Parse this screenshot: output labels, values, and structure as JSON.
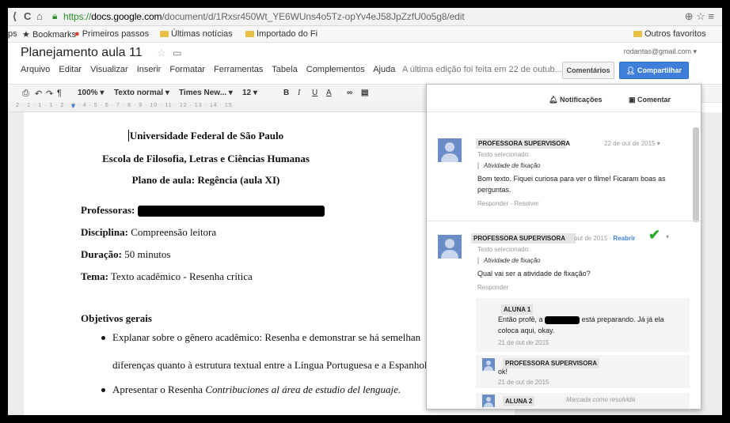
{
  "browser": {
    "url_https": "https://",
    "url_domain": "docs.google.com",
    "url_path": "/document/d/1Rxsr450Wt_YE6WUns4o5Tz-opYv4eJ58JpZzfU0o5g8/edit",
    "bookmarks": [
      {
        "label": "ps"
      },
      {
        "label": "Bookmarks"
      },
      {
        "label": "Primeiros passos"
      },
      {
        "label": "Últimas notícias"
      },
      {
        "label": "Importado do Fi"
      }
    ],
    "other_bookmarks": "Outros favoritos"
  },
  "doc": {
    "title": "Planejamento aula 11",
    "menu": [
      "Arquivo",
      "Editar",
      "Visualizar",
      "Inserir",
      "Formatar",
      "Ferramentas",
      "Tabela",
      "Complementos",
      "Ajuda"
    ],
    "last_edit": "A última edição foi feita em 22 de outub...",
    "user_email": "rodantas@gmail.com",
    "comments_button": "Comentários",
    "share_button": "Compartilhar"
  },
  "toolbar": {
    "zoom": "100%",
    "style": "Texto normal",
    "font": "Times New...",
    "size": "12",
    "bold": "B",
    "italic": "I",
    "underline": "U",
    "textcolor": "A"
  },
  "ruler": "2 · 1 · 1 · 1 · 2 · 3 · 4 · 5 · 6 · 7 · 8 · 9 · 10 · 11 · 12 · 13 · 14 · 15",
  "content": {
    "header1": "Universidade Federal de São Paulo",
    "header2": "Escola de Filosofia, Letras e Ciências Humanas",
    "header3": "Plano de aula: Regência (aula XI)",
    "professoras_label": "Professoras:",
    "disciplina_label": "Disciplina:",
    "disciplina_value": " Compreensão leitora",
    "duracao_label": "Duração:",
    "duracao_value": " 50 minutos",
    "tema_label": "Tema:",
    "tema_value": " Texto acadêmico - Resenha crítica",
    "objetivos": "Objetivos gerais",
    "bullet1_line1": "Explanar sobre o gênero acadêmico: Resenha e demonstrar se há semelhan",
    "bullet1_line2": "diferenças quanto à estrutura textual entre a Língua Portuguesa e a Espanhola.",
    "bullet2_prefix": "Apresentar o Resenha ",
    "bullet2_italic": "Contribuciones al área de estudio del lenguaje."
  },
  "comments": {
    "notifications": "Notificações",
    "comment_button": "Comentar",
    "thread1": {
      "author": "PROFESSORA SUPERVISORA",
      "date": "22 de out de 2015",
      "selected_label": "Texto selecionado:",
      "selected": "Atividade de fixação",
      "body": "Bom texto. Fiquei curiosa para ver o filme! Ficaram boas as perguntas.",
      "actions": "Responder - Resolver"
    },
    "thread2": {
      "author": "PROFESSORA SUPERVISORA",
      "date": "out de 2015 -",
      "reopen": "Reabrir",
      "selected_label": "Texto selecionado:",
      "selected": "Atividade de fixação",
      "body": "Qual vai ser a atividade de fixação?",
      "reply": "Responder"
    },
    "reply1": {
      "author": "ALUNA 1",
      "body_prefix": "Então profê, a",
      "body_suffix": "está preparando. Já já ela coloca aqui, okay.",
      "date": "21 de out de 2015"
    },
    "reply2": {
      "author": "PROFESSORA SUPERVISORA",
      "body": "ok!",
      "date": "21 de out de 2015"
    },
    "reply3": {
      "author": "ALUNA 2",
      "status": "Marcada como resolvida"
    }
  }
}
